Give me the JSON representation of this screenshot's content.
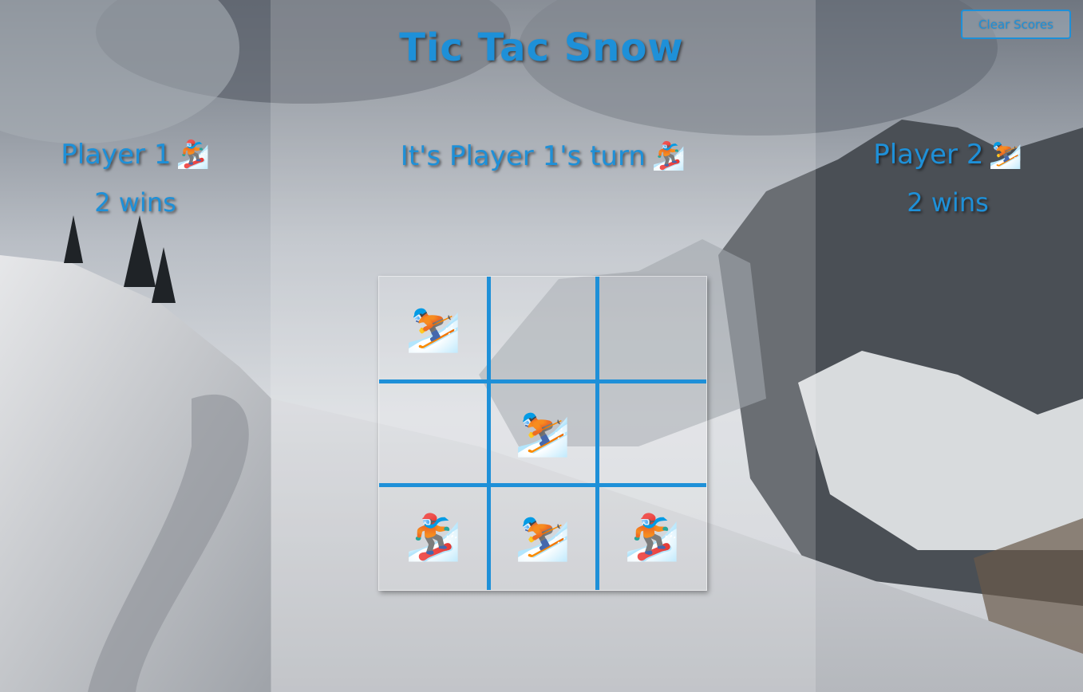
{
  "app": {
    "title": "Tic Tac Snow",
    "clear_scores_label": "Clear Scores"
  },
  "players": {
    "p1": {
      "name": "Player 1",
      "icon": "snowboarder-icon",
      "glyph": "🏂",
      "wins": "2 wins"
    },
    "p2": {
      "name": "Player 2",
      "icon": "skier-icon",
      "glyph": "⛷️",
      "wins": "2 wins"
    }
  },
  "turn": {
    "text": "It's Player 1's turn",
    "glyph": "🏂"
  },
  "board": {
    "cells": [
      {
        "mark": "⛷️",
        "owner": "p2"
      },
      {
        "mark": "",
        "owner": ""
      },
      {
        "mark": "",
        "owner": ""
      },
      {
        "mark": "",
        "owner": ""
      },
      {
        "mark": "⛷️",
        "owner": "p2"
      },
      {
        "mark": "",
        "owner": ""
      },
      {
        "mark": "🏂",
        "owner": "p1"
      },
      {
        "mark": "⛷️",
        "owner": "p2"
      },
      {
        "mark": "🏂",
        "owner": "p1"
      }
    ]
  },
  "colors": {
    "accent": "#1e90d8"
  }
}
